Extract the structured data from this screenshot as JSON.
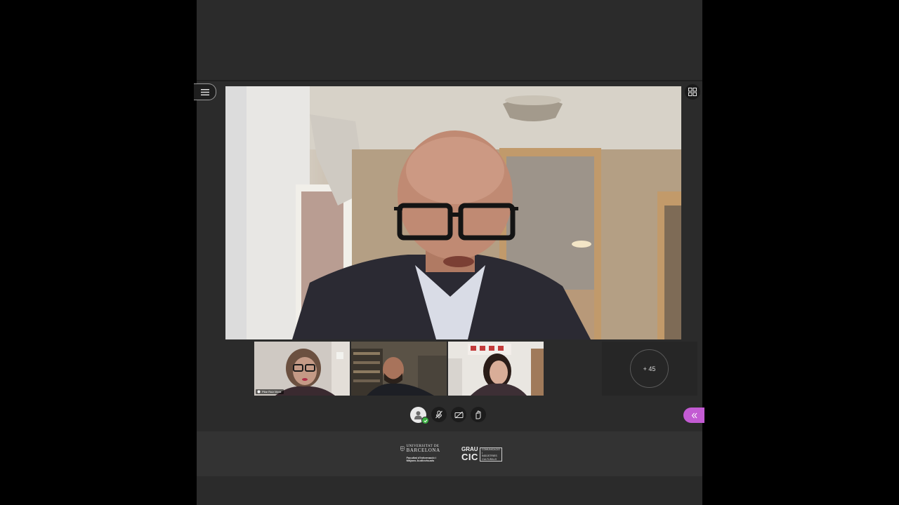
{
  "session": {
    "overflow_count": "+ 45"
  },
  "participants": [
    {
      "name": "Pilar Ruiz Mora"
    }
  ],
  "footer": {
    "ub_line1": "UNIVERSITAT DE",
    "ub_line2": "BARCELONA",
    "ub_line3": "Facultat d'Informació i Mitjans Audiovisuals",
    "cic_grau": "GRAU",
    "cic_name": "CIC",
    "cic_line1": "COMUNICACIÓ",
    "cic_line2": "I",
    "cic_line3": "INDÚSTRIES",
    "cic_line4": "CULTURALS"
  },
  "colors": {
    "accent": "#c35bd3",
    "status_ok": "#3cb043",
    "panel_bg": "#2b2b2b"
  },
  "icons": {
    "menu": "hamburger-icon",
    "grid": "grid-view-icon",
    "avatar": "user-avatar-icon",
    "mic": "microphone-off-icon",
    "camera": "camera-off-icon",
    "hand": "raise-hand-icon",
    "collab": "double-chevron-left-icon"
  }
}
